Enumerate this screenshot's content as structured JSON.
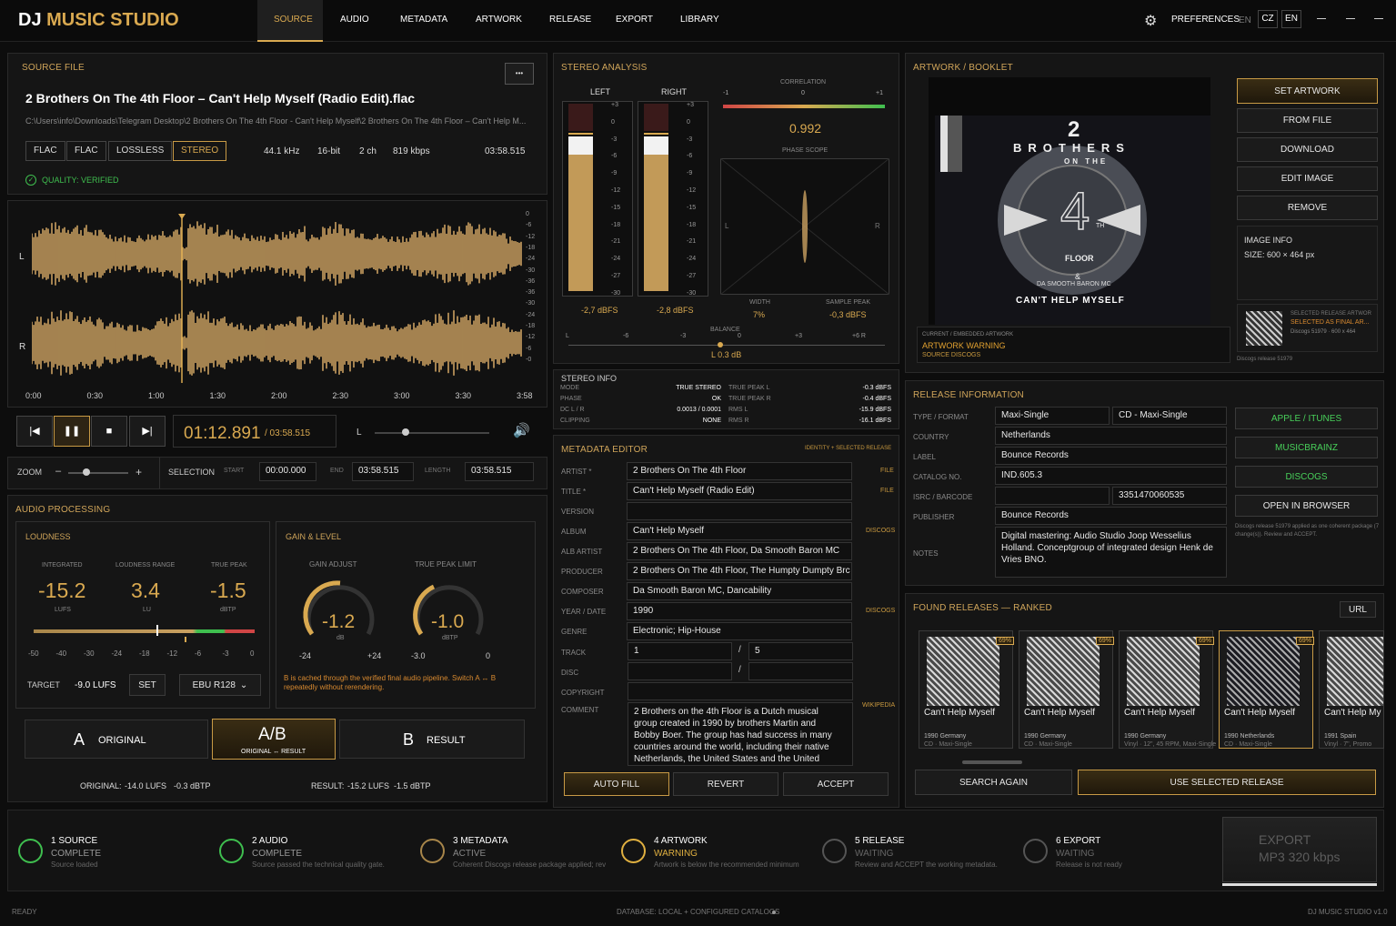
{
  "app": {
    "brand_dj": "DJ",
    "brand_rest": "MUSIC STUDIO",
    "tabs": [
      "SOURCE",
      "AUDIO",
      "METADATA",
      "ARTWORK",
      "RELEASE",
      "EXPORT",
      "LIBRARY"
    ],
    "preferences": "PREFERENCES",
    "lang_en": "EN",
    "lang_cz": "CZ",
    "lang_en2": "EN"
  },
  "source": {
    "title": "SOURCE FILE",
    "filename": "2 Brothers On The 4th Floor – Can't Help Myself (Radio Edit).flac",
    "path": "C:\\Users\\info\\Downloads\\Telegram Desktop\\2 Brothers On The 4th Floor - Can't Help Myself\\2 Brothers On The 4th Floor – Can't Help M...",
    "tags": [
      "FLAC",
      "FLAC",
      "LOSSLESS",
      "STEREO"
    ],
    "rate": "44.1 kHz",
    "bits": "16-bit",
    "ch": "2 ch",
    "kbps": "819 kbps",
    "duration": "03:58.515",
    "quality": "QUALITY: VERIFIED",
    "more": "•••"
  },
  "waveform": {
    "ch_l": "L",
    "ch_r": "R",
    "time_ticks": [
      "0:00",
      "0:30",
      "1:00",
      "1:30",
      "2:00",
      "2:30",
      "3:00",
      "3:30",
      "3:58"
    ],
    "db_ticks": [
      "0",
      "-6",
      "-12",
      "-18",
      "-24",
      "-30",
      "-36",
      "-36",
      "-30",
      "-24",
      "-18",
      "-12",
      "-6",
      "-0"
    ]
  },
  "transport": {
    "time": "01:12.891",
    "total": "/ 03:58.515",
    "l": "L"
  },
  "zoom": {
    "label": "ZOOM",
    "minus": "–",
    "plus": "+",
    "selection": "SELECTION",
    "start_l": "START",
    "start": "00:00.000",
    "end_l": "END",
    "end": "03:58.515",
    "length_l": "LENGTH",
    "length": "03:58.515"
  },
  "processing": {
    "title": "AUDIO PROCESSING",
    "loudness": "LOUDNESS",
    "integrated_l": "INTEGRATED",
    "integrated": "-15.2",
    "lufs": "LUFS",
    "range_l": "LOUDNESS RANGE",
    "range": "3.4",
    "lu": "LU",
    "peak_l": "TRUE PEAK",
    "peak": "-1.5",
    "dbtp": "dBTP",
    "scale": [
      "-50",
      "-40",
      "-30",
      "-24",
      "-18",
      "-12",
      "-6",
      "-3",
      "0"
    ],
    "target_l": "TARGET",
    "target": "-9.0 LUFS",
    "set": "SET",
    "ebu": "EBU R128",
    "gain_title": "GAIN & LEVEL",
    "gain_l": "GAIN ADJUST",
    "gain": "-1.2",
    "gain_u": "dB",
    "gain_min": "-24",
    "gain_max": "+24",
    "tpl_l": "TRUE PEAK LIMIT",
    "tpl": "-1.0",
    "tpl_u": "dBTP",
    "tpl_min": "-3.0",
    "tpl_max": "0",
    "note": "B is cached through the verified final audio pipeline. Switch A ↔ B repeatedly without rerendering.",
    "a": "A",
    "original": "ORIGINAL",
    "ab": "A/B",
    "ab_sub": "ORIGINAL ↔ RESULT",
    "b": "B",
    "result": "RESULT",
    "orig_stats_l": "ORIGINAL:",
    "orig_lufs": "-14.0 LUFS",
    "orig_dbtp": "-0.3 dBTP",
    "res_stats_l": "RESULT:",
    "res_lufs": "-15.2 LUFS",
    "res_dbtp": "-1.5 dBTP"
  },
  "stereo": {
    "title": "STEREO ANALYSIS",
    "left": "LEFT",
    "right": "RIGHT",
    "left_db": "-2,7 dBFS",
    "right_db": "-2,8 dBFS",
    "meter_ticks": [
      "+3",
      "0",
      "-3",
      "-6",
      "-9",
      "-12",
      "-15",
      "-18",
      "-21",
      "-24",
      "-27",
      "-30"
    ],
    "correlation_l": "CORRELATION",
    "corr_min": "-1",
    "corr_mid": "0",
    "corr_max": "+1",
    "correlation": "0.992",
    "phase_l": "PHASE SCOPE",
    "ps_l": "L",
    "ps_r": "R",
    "width_l": "WIDTH",
    "width": "7%",
    "sp_l": "SAMPLE PEAK",
    "sp": "-0,3 dBFS",
    "balance_l": "BALANCE",
    "balance": "L 0.3 dB",
    "bal_ticks": [
      "L",
      "-6",
      "-3",
      "0",
      "+3",
      "+6 R"
    ]
  },
  "stereo_info": {
    "title": "STEREO INFO",
    "rows": [
      [
        "MODE",
        "TRUE STEREO",
        "TRUE PEAK L",
        "-0.3 dBFS"
      ],
      [
        "PHASE",
        "OK",
        "TRUE PEAK R",
        "-0.4 dBFS"
      ],
      [
        "DC L / R",
        "0.0013 / 0.0001",
        "RMS L",
        "-15.9 dBFS"
      ],
      [
        "CLIPPING",
        "NONE",
        "RMS R",
        "-16.1 dBFS"
      ]
    ]
  },
  "metadata": {
    "title": "METADATA EDITOR",
    "hint": "IDENTITY + SELECTED RELEASE",
    "fields": [
      {
        "label": "ARTIST *",
        "value": "2 Brothers On The 4th Floor",
        "src": "FILE"
      },
      {
        "label": "TITLE *",
        "value": "Can't Help Myself (Radio Edit)",
        "src": "FILE"
      },
      {
        "label": "VERSION",
        "value": "",
        "src": ""
      },
      {
        "label": "ALBUM",
        "value": "Can't Help Myself",
        "src": "DISCOGS"
      },
      {
        "label": "ALB ARTIST",
        "value": "2 Brothers On The 4th Floor, Da Smooth Baron MC",
        "src": ""
      },
      {
        "label": "PRODUCER",
        "value": "2 Brothers On The 4th Floor, The Humpty Dumpty Brc",
        "src": ""
      },
      {
        "label": "COMPOSER",
        "value": "Da Smooth Baron MC, Dancability",
        "src": ""
      },
      {
        "label": "YEAR / DATE",
        "value": "1990",
        "src": "DISCOGS"
      },
      {
        "label": "GENRE",
        "value": "Electronic; Hip-House",
        "src": ""
      }
    ],
    "track_l": "TRACK",
    "track": "1",
    "track_of": "5",
    "disc_l": "DISC",
    "copyright_l": "COPYRIGHT",
    "comment_l": "COMMENT",
    "comment": "2 Brothers on the 4th Floor is a Dutch musical group created in 1990 by brothers Martin and Bobby Boer. The group has had success in many countries around the world, including their native Netherlands, the United States and the United",
    "comment_src": "WIKIPEDIA",
    "autofill": "AUTO FILL",
    "revert": "REVERT",
    "accept": "ACCEPT"
  },
  "artwork": {
    "title": "ARTWORK / BOOKLET",
    "cover_l1": "2",
    "cover_l2": "BROTHERS",
    "cover_l3": "ON THE",
    "cover_l4": "4",
    "cover_l5": "TH",
    "cover_l6": "FLOOR",
    "cover_l7": "&",
    "cover_l8": "DA SMOOTH BARON MC",
    "cover_l9": "CAN'T HELP MYSELF",
    "emb_l": "CURRENT / EMBEDDED ARTWORK",
    "warn": "ARTWORK WARNING",
    "emb_src": "SOURCE DISCOGS",
    "buttons": [
      "SET ARTWORK",
      "FROM FILE",
      "DOWNLOAD",
      "EDIT IMAGE",
      "REMOVE"
    ],
    "info_l": "IMAGE INFO",
    "size": "SIZE: 600 × 464 px",
    "sel_l": "SELECTED RELEASE ARTWOR",
    "sel_v": "SELECTED AS FINAL AR...",
    "sel_s": "Discogs 51979 · 600 x 464",
    "discogs": "Discogs release 51979"
  },
  "release": {
    "title": "RELEASE INFORMATION",
    "type_l": "TYPE / FORMAT",
    "type": "Maxi-Single",
    "format": "CD - Maxi-Single",
    "country_l": "COUNTRY",
    "country": "Netherlands",
    "label_l": "LABEL",
    "label": "Bounce Records",
    "cat_l": "CATALOG NO.",
    "cat": "IND.605.3",
    "isrc_l": "ISRC / BARCODE",
    "barcode": "3351470060535",
    "pub_l": "PUBLISHER",
    "pub": "Bounce Records",
    "notes_l": "NOTES",
    "notes": "Digital mastering: Audio Studio Joop Wesselius Holland. Conceptgroup of integrated design Henk de Vries BNO.",
    "links": [
      "APPLE / iTUNES",
      "MUSICBRAINZ",
      "DISCOGS"
    ],
    "open": "OPEN IN BROWSER",
    "note": "Discogs release 51979 applied as one coherent package (7 change(s)). Review and ACCEPT."
  },
  "found": {
    "title": "FOUND RELEASES — RANKED",
    "url": "URL",
    "cards": [
      {
        "pct": "69%",
        "title": "Can't Help Myself",
        "year": "1990  Germany",
        "fmt": "CD · Maxi-Single"
      },
      {
        "pct": "69%",
        "title": "Can't Help Myself",
        "year": "1990  Germany",
        "fmt": "CD · Maxi-Single"
      },
      {
        "pct": "69%",
        "title": "Can't Help Myself",
        "year": "1990  Germany",
        "fmt": "Vinyl · 12\", 45 RPM, Maxi-Single"
      },
      {
        "pct": "69%",
        "title": "Can't Help Myself",
        "year": "1990  Netherlands",
        "fmt": "CD · Maxi-Single"
      },
      {
        "pct": "",
        "title": "Can't Help My",
        "year": "1991  Spain",
        "fmt": "Vinyl · 7\", Promo"
      }
    ],
    "search": "SEARCH AGAIN",
    "use": "USE SELECTED RELEASE"
  },
  "steps": [
    {
      "t": "1 SOURCE",
      "s": "COMPLETE",
      "d": "Source loaded",
      "c": "#3fbf4f"
    },
    {
      "t": "2 AUDIO",
      "s": "COMPLETE",
      "d": "Source passed the technical quality gate.",
      "c": "#3fbf4f"
    },
    {
      "t": "3 METADATA",
      "s": "ACTIVE",
      "d": "Coherent Discogs release package applied; rev",
      "c": "#a8864a"
    },
    {
      "t": "4 ARTWORK",
      "s": "WARNING",
      "d": "Artwork is below the recommended minimum",
      "c": "#e0b040"
    },
    {
      "t": "5 RELEASE",
      "s": "WAITING",
      "d": "Review and ACCEPT the working metadata.",
      "c": "#555"
    },
    {
      "t": "6 EXPORT",
      "s": "WAITING",
      "d": "Release is not ready",
      "c": "#555"
    }
  ],
  "export": {
    "l1": "EXPORT",
    "l2": "MP3 320 kbps"
  },
  "status": {
    "ready": "READY",
    "db": "DATABASE: LOCAL + CONFIGURED CATALOGS",
    "ver": "DJ MUSIC STUDIO v1.0"
  },
  "colors": {
    "accent": "#d9a950",
    "green": "#3fbf4f",
    "bg": "#0d0d0d"
  }
}
